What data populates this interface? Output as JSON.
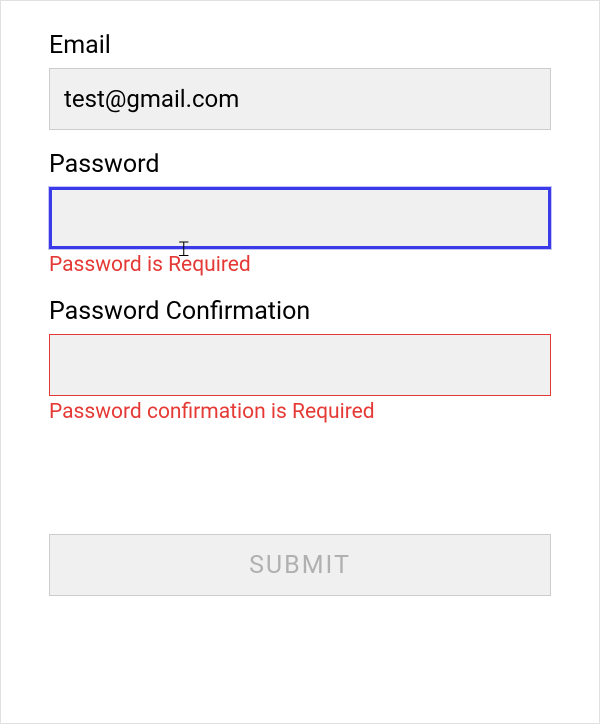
{
  "email": {
    "label": "Email",
    "value": "test@gmail.com"
  },
  "password": {
    "label": "Password",
    "value": "",
    "error": "Password is Required"
  },
  "passwordConfirmation": {
    "label": "Password Confirmation",
    "value": "",
    "error": "Password confirmation is Required"
  },
  "submit": {
    "label": "SUBMIT"
  }
}
